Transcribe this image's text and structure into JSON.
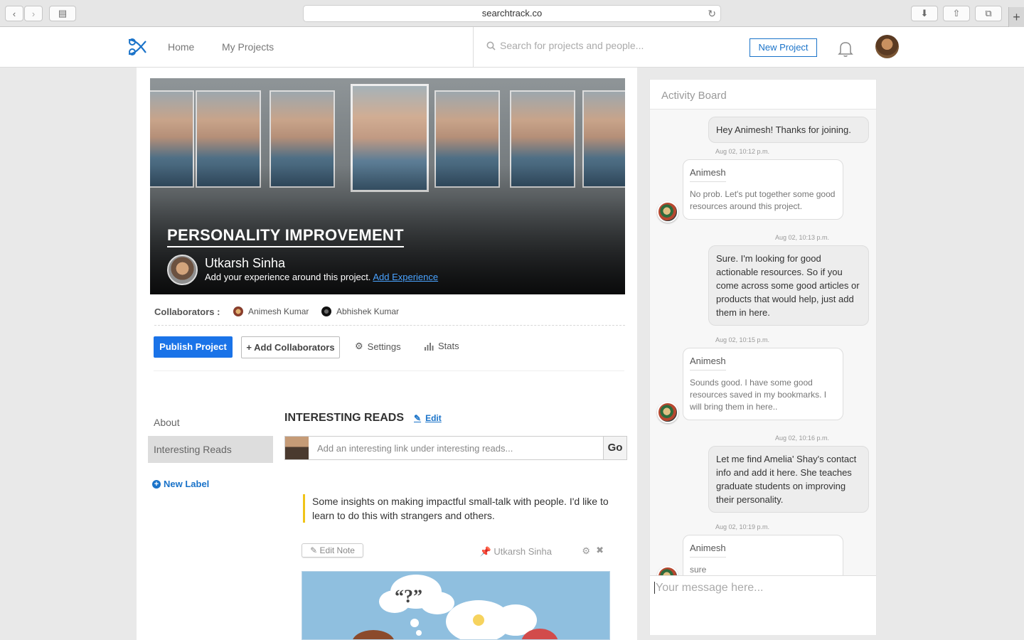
{
  "browser": {
    "url": "searchtrack.co"
  },
  "nav": {
    "home": "Home",
    "my_projects": "My Projects",
    "search_placeholder": "Search for projects and people...",
    "new_project": "New Project"
  },
  "project": {
    "title": "PERSONALITY IMPROVEMENT",
    "owner": "Utkarsh Sinha",
    "cta_text": "Add your experience around this project.",
    "cta_link": "Add Experience",
    "collaborators_label": "Collaborators :",
    "collaborators": [
      "Animesh Kumar",
      "Abhishek Kumar"
    ],
    "actions": {
      "publish": "Publish Project",
      "add_collaborators": "Add Collaborators",
      "settings": "Settings",
      "stats": "Stats"
    }
  },
  "labels": {
    "items": [
      "About",
      "Interesting Reads"
    ],
    "new_label": "New Label"
  },
  "reads": {
    "title": "INTERESTING READS",
    "edit": "Edit",
    "input_placeholder": "Add an interesting link under interesting reads...",
    "go": "Go",
    "note": "Some insights on making impactful small-talk with people. I'd like to learn to do this with strangers and others.",
    "edit_note": "Edit Note",
    "pinned_by": "Utkarsh Sinha"
  },
  "activity": {
    "title": "Activity Board",
    "messages": [
      {
        "from": "self",
        "text": "Hey Animesh! Thanks for joining.",
        "time": "Aug 02, 10:12 p.m."
      },
      {
        "from": "Animesh",
        "text": "No prob. Let's put together some good resources around this project.",
        "time": "Aug 02, 10:13 p.m."
      },
      {
        "from": "self",
        "text": "Sure. I'm looking for good actionable resources. So if you come across some good articles or products that would help, just add them in here.",
        "time": "Aug 02, 10:15 p.m."
      },
      {
        "from": "Animesh",
        "text": "Sounds good. I have some good resources saved in my bookmarks. I will bring them in here..",
        "time": "Aug 02, 10:16 p.m."
      },
      {
        "from": "self",
        "text": "Let me find Amelia' Shay's contact info and add it here. She teaches graduate students on improving their personality.",
        "time": "Aug 02, 10:19 p.m."
      },
      {
        "from": "Animesh",
        "text": "sure",
        "time": ""
      }
    ],
    "composer_placeholder": "Your message here..."
  },
  "colors": {
    "primary": "#1a73e8",
    "link": "#1a73c9",
    "note_accent": "#f0c419"
  }
}
